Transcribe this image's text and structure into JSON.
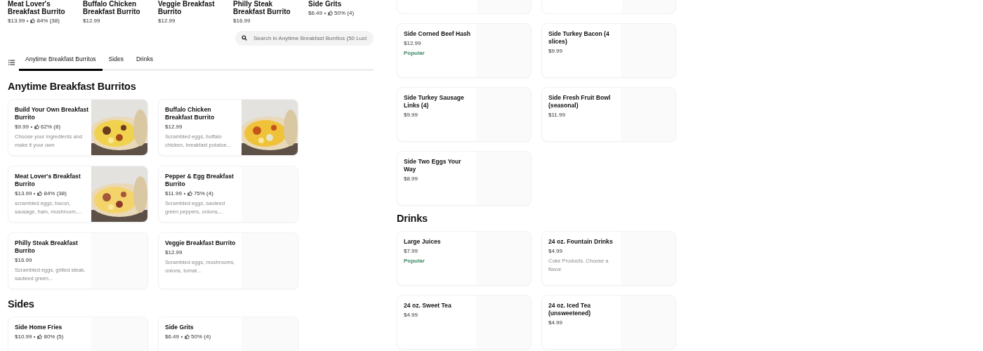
{
  "recent_items": [
    {
      "title": "Meat Lover's Breakfast Burrito",
      "price": "$13.99",
      "rating": "84% (38)"
    },
    {
      "title": "Buffalo Chicken Breakfast Burrito",
      "price": "$12.99"
    },
    {
      "title": "Veggie Breakfast Burrito",
      "price": "$12.99"
    },
    {
      "title": "Philly Steak Breakfast Burrito",
      "price": "$16.99"
    },
    {
      "title": "Side Grits",
      "price": "$6.49",
      "rating": "50% (4)"
    }
  ],
  "search": {
    "placeholder": "Search in Anytime Breakfast Burritos (50 Lucl"
  },
  "tabs": [
    {
      "label": "Anytime Breakfast Burritos",
      "selected": true
    },
    {
      "label": "Sides",
      "selected": false
    },
    {
      "label": "Drinks",
      "selected": false
    }
  ],
  "left_sections": [
    {
      "title": "Anytime Breakfast Burritos",
      "items": [
        {
          "title": "Build Your Own Breakfast Burrito",
          "price": "$9.99",
          "rating": "62% (8)",
          "description": "Choose your ingredients and make it your own"
        },
        {
          "title": "Buffalo Chicken Breakfast Burrito",
          "price": "$12.99",
          "description": "Scrambled eggs, buffalo chicken, breakfast potatoe..."
        },
        {
          "title": "Meat Lover's Breakfast Burrito",
          "price": "$13.99",
          "rating": "84% (38)",
          "description": "scrambled eggs, bacon, sausage, ham, mushroom,..."
        },
        {
          "title": "Pepper & Egg Breakfast Burrito",
          "price": "$11.99",
          "rating": "75% (4)",
          "description": "Scrambled eggs, sauteed green peppers, onions,...",
          "kind": "plain"
        },
        {
          "title": "Philly Steak Breakfast Burrito",
          "price": "$16.99",
          "description": "Scrambled eggs, grilled steak, sauteed green...",
          "kind": "plain"
        },
        {
          "title": "Veggie Breakfast Burrito",
          "price": "$12.99",
          "description": "Scrambled eggs, mushrooms, onions, tomat...",
          "kind": "plain"
        }
      ]
    },
    {
      "title": "Sides",
      "items": [
        {
          "title": "Side Home Fries",
          "price": "$10.99",
          "rating": "80% (5)",
          "kind": "plain"
        },
        {
          "title": "Side Grits",
          "price": "$6.49",
          "rating": "50% (4)",
          "kind": "plain"
        }
      ]
    }
  ],
  "right_sections": [
    {
      "items": [
        {
          "title": "Side Corned Beef Hash",
          "price": "$12.99",
          "badge": "Popular"
        },
        {
          "title": "Side Turkey Bacon (4 slices)",
          "price": "$9.99"
        },
        {
          "title": "Side Turkey Sausage Links (4)",
          "price": "$9.99"
        },
        {
          "title": "Side Fresh Fruit Bowl (seasonal)",
          "price": "$11.99"
        },
        {
          "title": "Side Two Eggs Your Way",
          "price": "$8.99"
        }
      ]
    },
    {
      "title": "Drinks",
      "items": [
        {
          "title": "Large Juices",
          "price": "$7.99",
          "badge": "Popular"
        },
        {
          "title": "24 oz. Fountain Drinks",
          "price": "$4.99",
          "description": "Coke Products. Choose a flavor."
        },
        {
          "title": "24 oz. Sweet Tea",
          "price": "$4.99"
        },
        {
          "title": "24 oz. Iced Tea (unsweetened)",
          "price": "$4.99"
        }
      ]
    }
  ]
}
